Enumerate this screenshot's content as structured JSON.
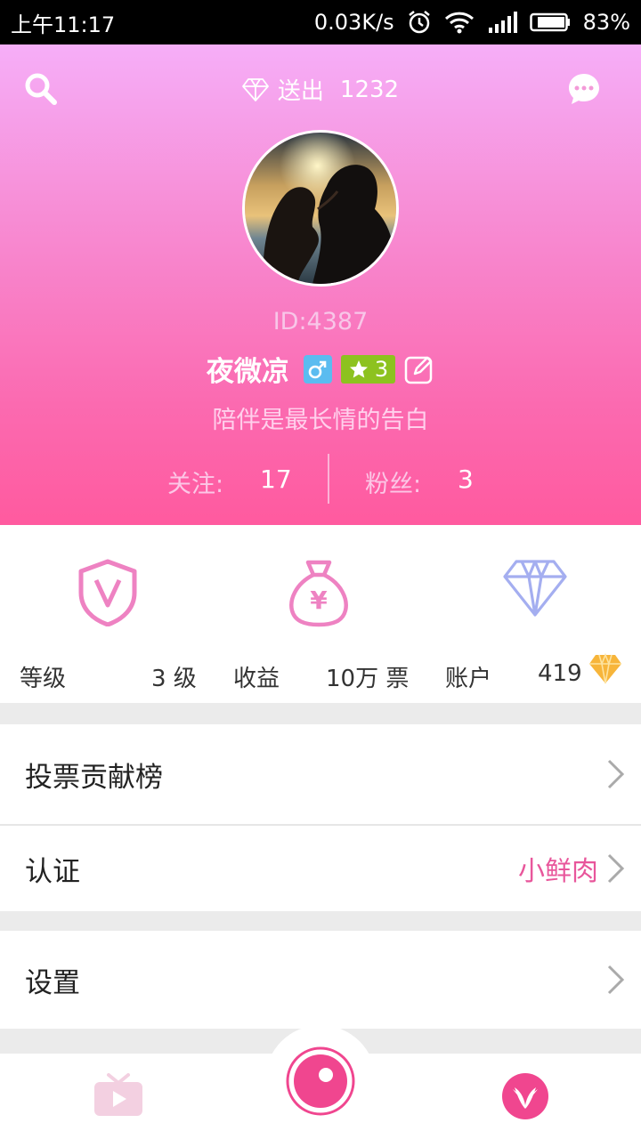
{
  "status_bar": {
    "time": "上午11:17",
    "speed": "0.03K/s",
    "battery": "83%"
  },
  "header": {
    "sent_label": "送出",
    "sent_count": "1232",
    "user_id": "ID:4387",
    "username": "夜微凉",
    "level_badge": "3",
    "bio": "陪伴是最长情的告白",
    "follow_label": "关注:",
    "follow_count": "17",
    "fans_label": "粉丝:",
    "fans_count": "3"
  },
  "stats": {
    "level_label": "等级",
    "level_value": "3 级",
    "income_label": "收益",
    "income_value": "10万 票",
    "account_label": "账户",
    "account_value": "419"
  },
  "menu": {
    "vote_rank": "投票贡献榜",
    "verify": "认证",
    "verify_tag": "小鲜肉",
    "settings": "设置"
  },
  "colors": {
    "accent_pink": "#ff5a9f",
    "tag_pink": "#e8569b",
    "gender_blue": "#5bbcf0",
    "level_green": "#8dc21f"
  },
  "icons": [
    "search-icon",
    "diamond-icon",
    "chat-icon",
    "male-icon",
    "star-icon",
    "edit-icon",
    "shield-v-icon",
    "money-bag-icon",
    "diamond-outline-icon",
    "gold-diamond-icon",
    "chevron-right-icon",
    "tv-icon",
    "camera-icon",
    "profile-icon"
  ]
}
